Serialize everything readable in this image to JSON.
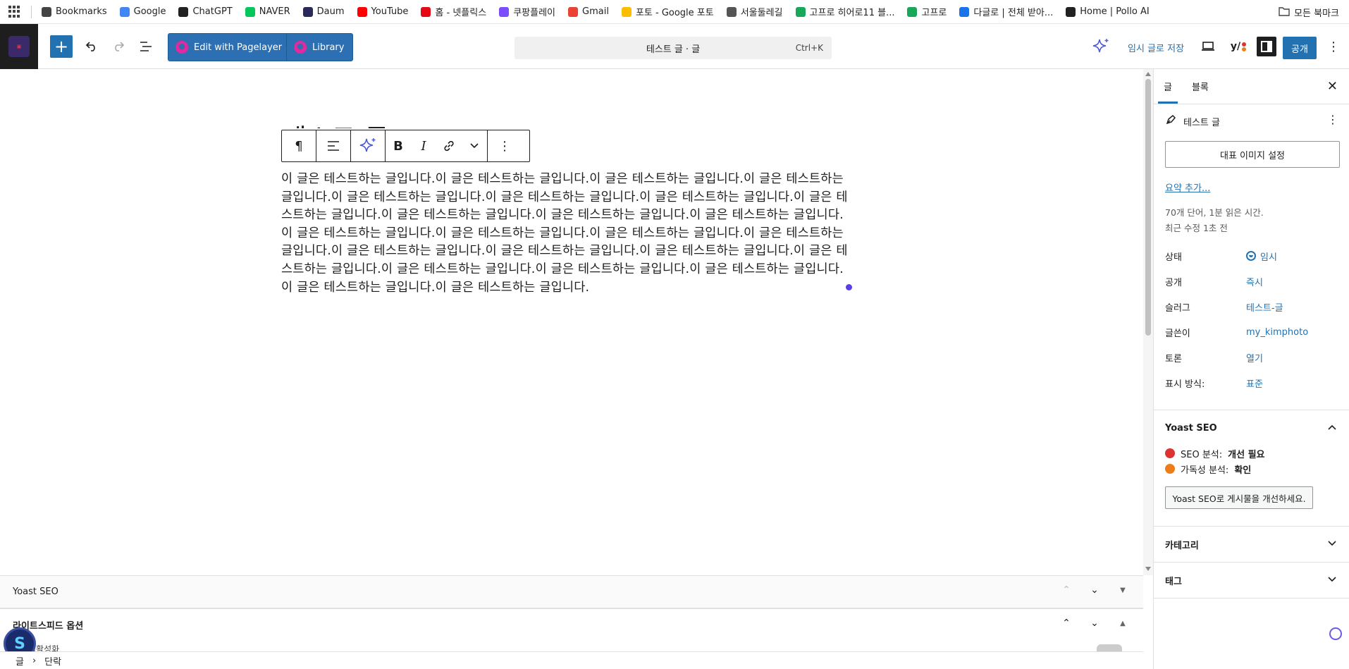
{
  "bookmarks_bar": {
    "items": [
      {
        "label": "Bookmarks",
        "icon": "star-icon",
        "color": "#444444"
      },
      {
        "label": "Google",
        "icon": "google-icon",
        "color": "#4285f4"
      },
      {
        "label": "ChatGPT",
        "icon": "chatgpt-icon",
        "color": "#222222"
      },
      {
        "label": "NAVER",
        "icon": "naver-icon",
        "color": "#03c75a"
      },
      {
        "label": "Daum",
        "icon": "daum-icon",
        "color": "#2a2a5a"
      },
      {
        "label": "YouTube",
        "icon": "youtube-icon",
        "color": "#ff0000"
      },
      {
        "label": "홈 - 넷플릭스",
        "icon": "netflix-icon",
        "color": "#e50914"
      },
      {
        "label": "쿠팡플레이",
        "icon": "coupangplay-icon",
        "color": "#7b4dff"
      },
      {
        "label": "Gmail",
        "icon": "gmail-icon",
        "color": "#ea4335"
      },
      {
        "label": "포토 - Google 포토",
        "icon": "google-photos-icon",
        "color": "#fbbc04"
      },
      {
        "label": "서울둘레길",
        "icon": "globe-icon",
        "color": "#555555"
      },
      {
        "label": "고프로 히어로11 블...",
        "icon": "gopro-icon",
        "color": "#19a85a"
      },
      {
        "label": "고프로",
        "icon": "gopro-icon",
        "color": "#19a85a"
      },
      {
        "label": "다글로 | 전체 받아...",
        "icon": "daglo-icon",
        "color": "#1a73e8"
      },
      {
        "label": "Home | Pollo AI",
        "icon": "pollo-icon",
        "color": "#222222"
      }
    ],
    "all_bookmarks": "모든 북마크"
  },
  "header": {
    "pagelayer_label": "Edit with Pagelayer",
    "library_label": "Library",
    "command_text": "테스트 글 · 글",
    "command_shortcut": "Ctrl+K",
    "save_draft": "임시 글로 저장",
    "yoast_badge": "y/",
    "publish": "공개",
    "accent_color": "#2271b1"
  },
  "editor": {
    "title_peek": "테스트 글",
    "paragraph": "이 글은 테스트하는 글입니다.이 글은 테스트하는 글입니다.이 글은 테스트하는 글입니다.이 글은 테스트하는 글입니다.이 글은 테스트하는 글입니다.이 글은 테스트하는 글입니다.이 글은 테스트하는 글입니다.이 글은 테스트하는 글입니다.이 글은 테스트하는 글입니다.이 글은 테스트하는 글입니다.이 글은 테스트하는 글입니다.이 글은 테스트하는 글입니다.이 글은 테스트하는 글입니다.이 글은 테스트하는 글입니다.이 글은 테스트하는 글입니다.이 글은 테스트하는 글입니다.이 글은 테스트하는 글입니다.이 글은 테스트하는 글입니다.이 글은 테스트하는 글입니다.이 글은 테스트하는 글입니다.이 글은 테스트하는 글입니다.이 글은 테스트하는 글입니다.이 글은 테스트하는 글입니다.이 글은 테스트하는 글입니다."
  },
  "metaboxes": {
    "yoast": "Yoast SEO",
    "litespeed": "라이트스피드 옵션",
    "litespeed_sub": "비활성화"
  },
  "breadcrumb": {
    "root": "글",
    "separator": "›",
    "current": "단락"
  },
  "sidebar": {
    "tabs": [
      "글",
      "블록"
    ],
    "post_title": "테스트 글",
    "featured_image": "대표 이미지 설정",
    "excerpt": "요약 추가...",
    "stats_words": "70개 단어, 1분 읽은 시간.",
    "stats_modified": "최근 수정 1초 전",
    "meta": [
      {
        "key": "상태",
        "value": "임시"
      },
      {
        "key": "공개",
        "value": "즉시"
      },
      {
        "key": "슬러그",
        "value": "테스트-글"
      },
      {
        "key": "글쓴이",
        "value": "my_kimphoto"
      },
      {
        "key": "토론",
        "value": "열기"
      },
      {
        "key": "표시 방식:",
        "value": "표준"
      }
    ],
    "yoast": {
      "title": "Yoast SEO",
      "seo_label": "SEO 분석:",
      "seo_value": "개선 필요",
      "seo_color": "#dc3232",
      "read_label": "가독성 분석:",
      "read_value": "확인",
      "read_color": "#ee7c1b",
      "button": "Yoast SEO로 게시물을 개선하세요."
    },
    "categories": "카테고리",
    "tags": "태그"
  }
}
